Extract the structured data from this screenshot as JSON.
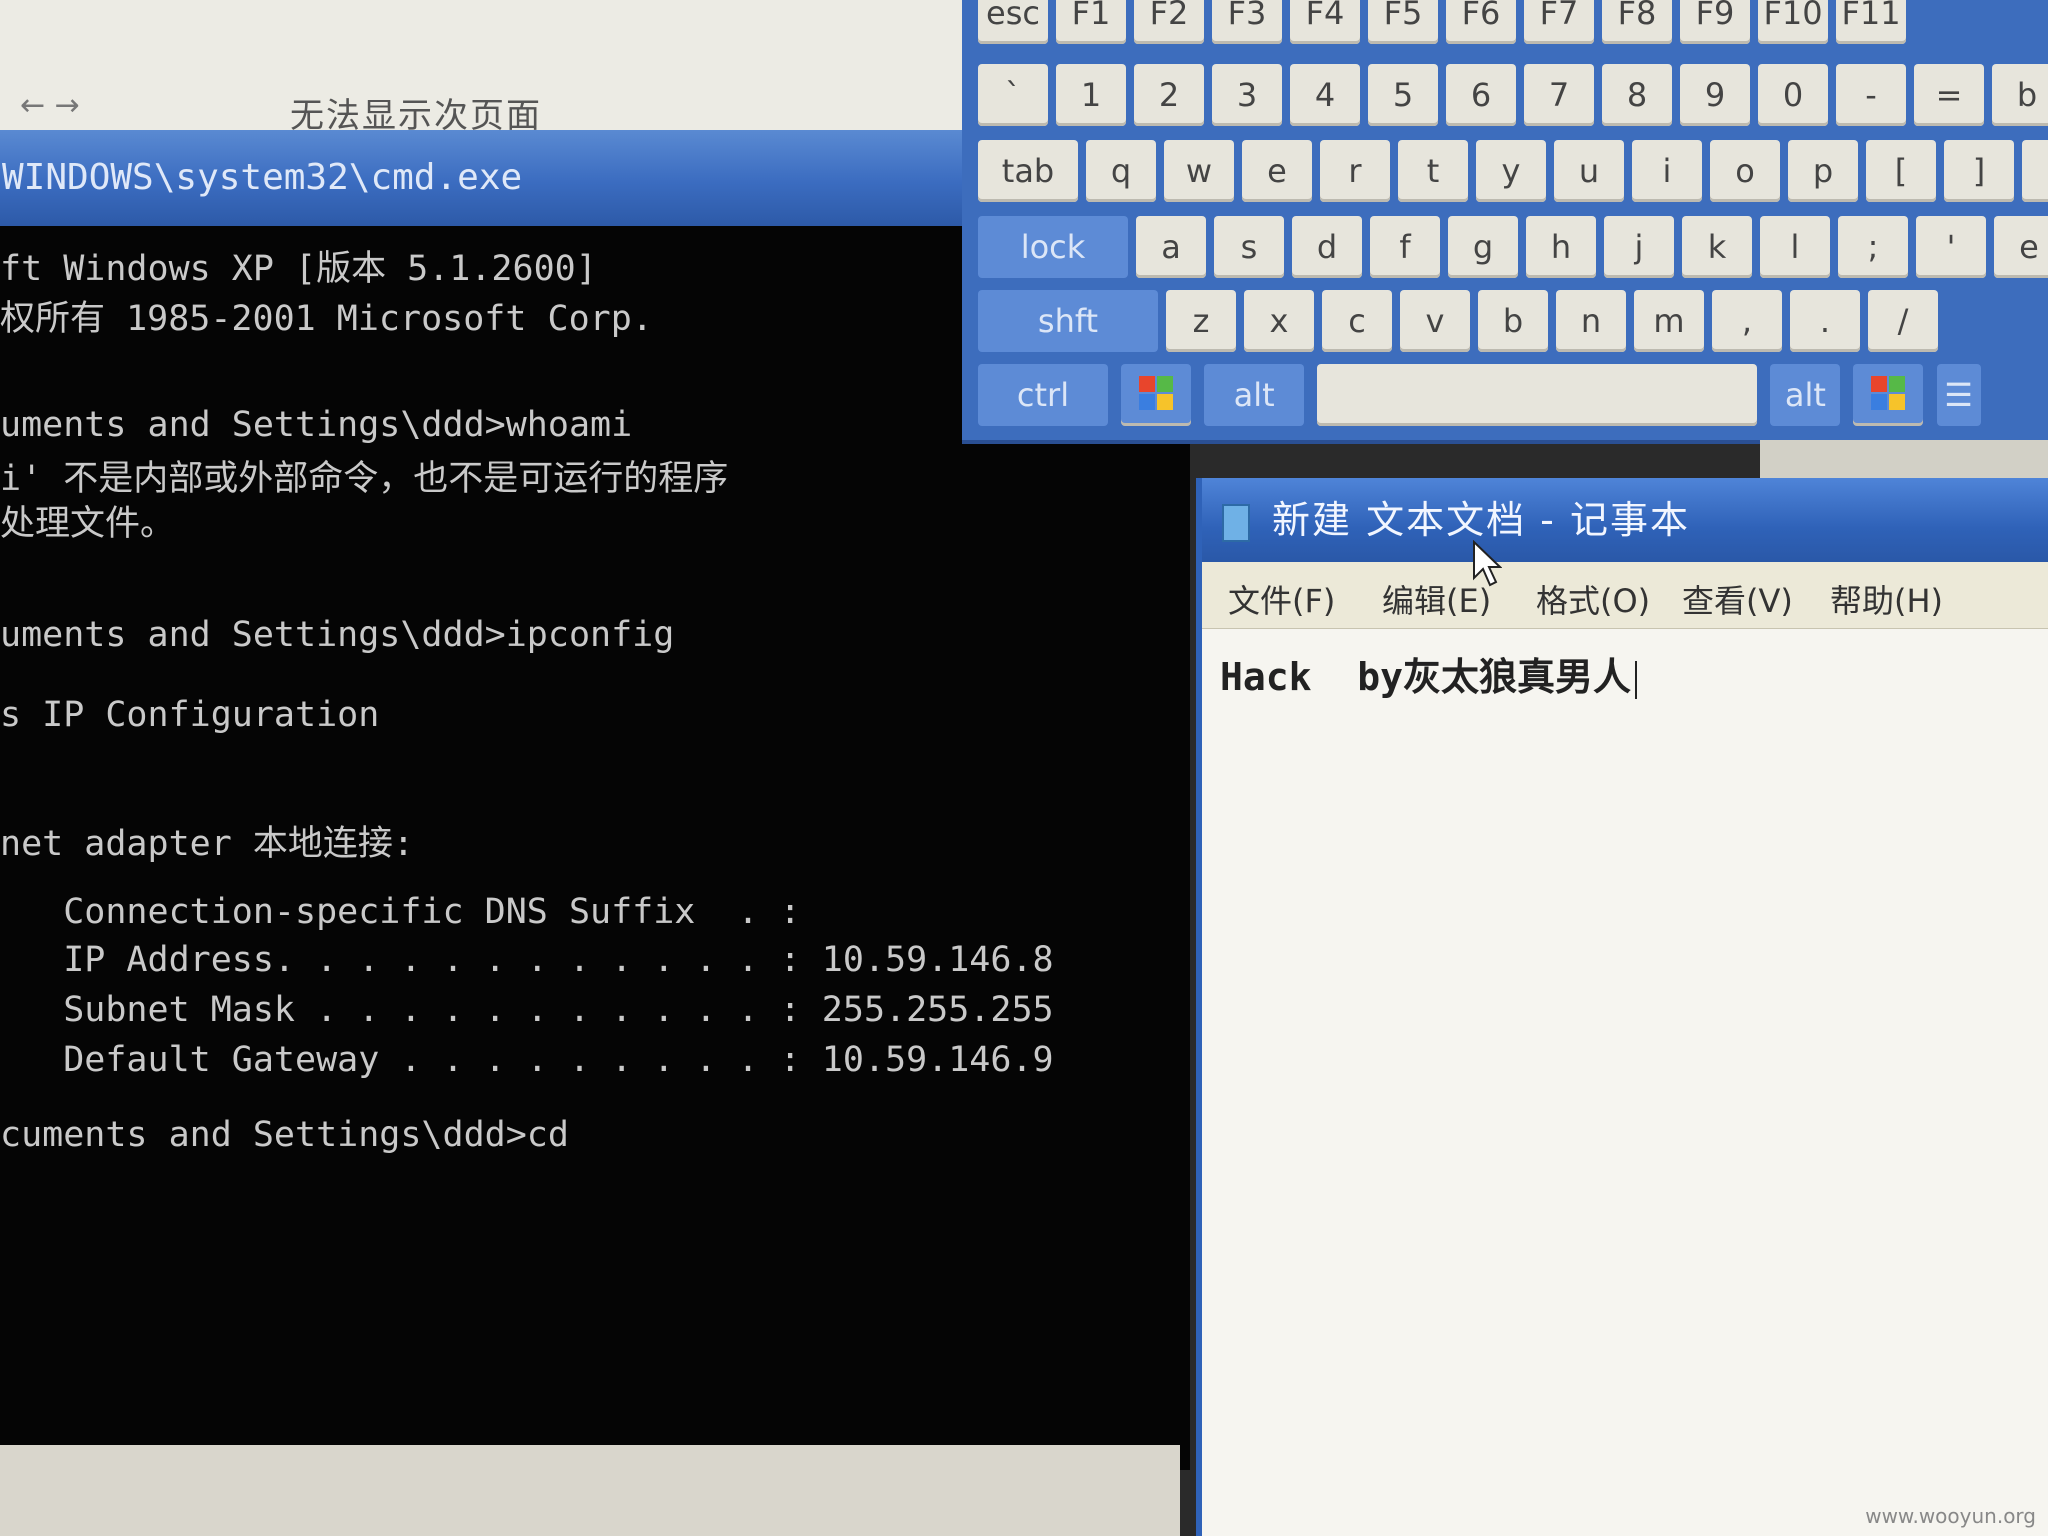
{
  "background_window": {
    "title_fragment": "无法显示次页面",
    "arrow": "←  →"
  },
  "cmd": {
    "title": "WINDOWS\\system32\\cmd.exe",
    "lines": [
      "ft Windows XP [版本 5.1.2600]",
      "权所有 1985-2001 Microsoft Corp.",
      "",
      "uments and Settings\\ddd>whoami",
      "i' 不是内部或外部命令，也不是可运行的程序",
      "处理文件。",
      "",
      "uments and Settings\\ddd>ipconfig",
      "",
      "s IP Configuration",
      "",
      "",
      "net adapter 本地连接:",
      "",
      "   Connection-specific DNS Suffix  . :",
      "   IP Address. . . . . . . . . . . . : 10.59.146.8",
      "   Subnet Mask . . . . . . . . . . . : 255.255.255",
      "   Default Gateway . . . . . . . . . : 10.59.146.9",
      "",
      "cuments and Settings\\ddd>cd"
    ]
  },
  "keyboard": {
    "row_fn": [
      "esc",
      "F1",
      "F2",
      "F3",
      "F4",
      "F5",
      "F6",
      "F7",
      "F8",
      "F9",
      "F10",
      "F11"
    ],
    "row_num": [
      "`",
      "1",
      "2",
      "3",
      "4",
      "5",
      "6",
      "7",
      "8",
      "9",
      "0",
      "-",
      "=",
      "b"
    ],
    "row_tab": [
      "tab",
      "q",
      "w",
      "e",
      "r",
      "t",
      "y",
      "u",
      "i",
      "o",
      "p",
      "[",
      "]",
      "\\"
    ],
    "row_lock": [
      "lock",
      "a",
      "s",
      "d",
      "f",
      "g",
      "h",
      "j",
      "k",
      "l",
      ";",
      "'",
      "e"
    ],
    "row_shift": [
      "shft",
      "z",
      "x",
      "c",
      "v",
      "b",
      "n",
      "m",
      ",",
      ".",
      "/"
    ],
    "row_ctrl": {
      "ctrl": "ctrl",
      "alt_left": "alt",
      "alt_right": "alt"
    }
  },
  "notepad": {
    "title": "新建 文本文档 - 记事本",
    "menu": [
      "文件(F)",
      "编辑(E)",
      "格式(O)",
      "查看(V)",
      "帮助(H)"
    ],
    "content": "Hack  by灰太狼真男人"
  },
  "watermark": "www.wooyun.org",
  "colors": {
    "xp_blue": "#3b6cc0",
    "console_bg": "#050505",
    "console_text": "#c9c9c9"
  }
}
